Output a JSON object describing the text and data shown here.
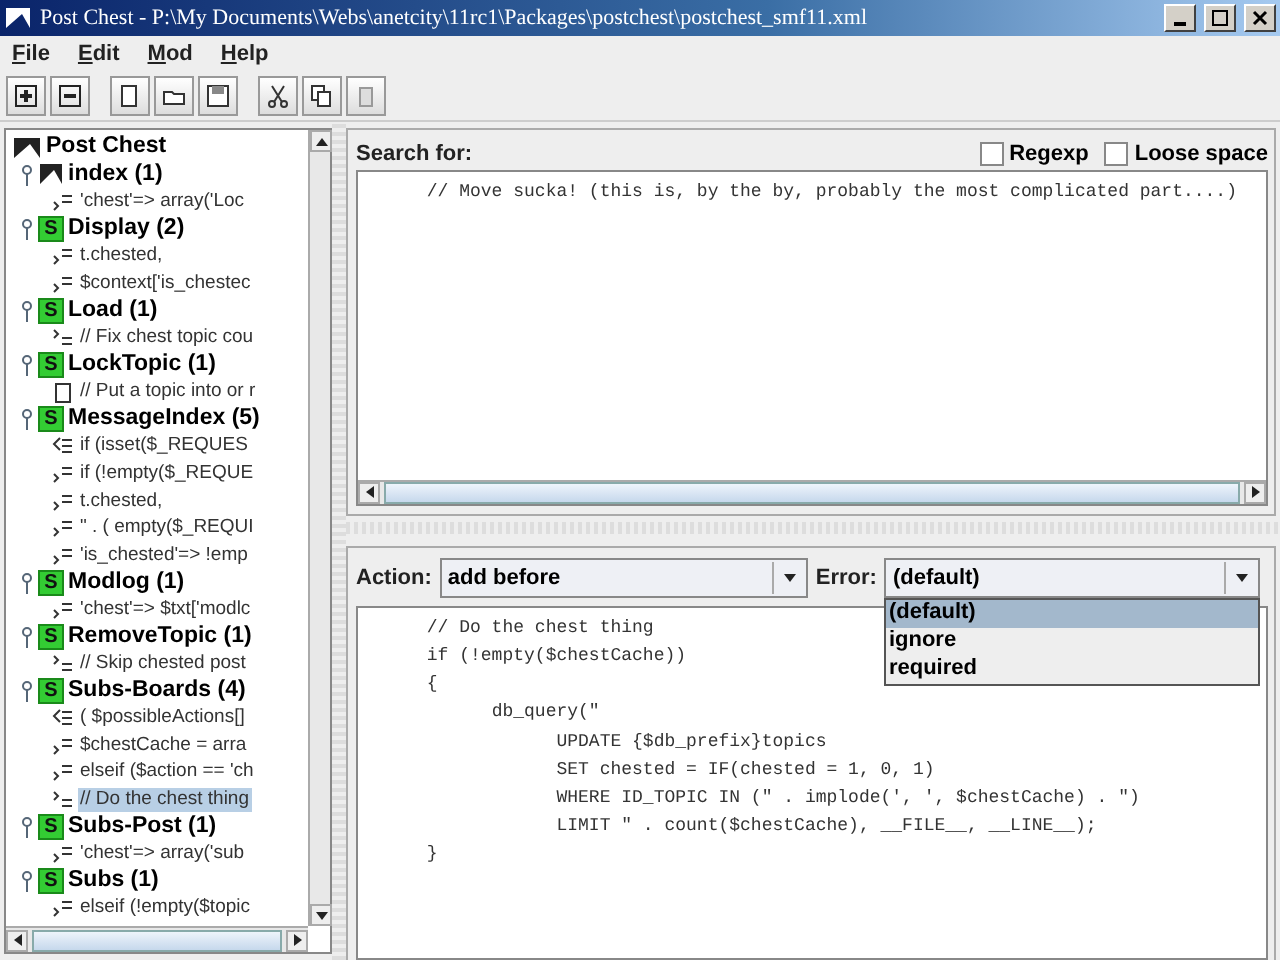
{
  "window": {
    "title": "Post Chest - P:\\My Documents\\Webs\\anetcity\\11rc1\\Packages\\postchest\\postchest_smf11.xml"
  },
  "menu": [
    "File",
    "Edit",
    "Mod",
    "Help"
  ],
  "tree": {
    "label": "Post Chest",
    "children": [
      {
        "label": "index (1)",
        "kind": "index",
        "children": [
          {
            "text": "'chest'=> array('Loc",
            "kind": "after",
            "selected": false
          }
        ]
      },
      {
        "label": "Display (2)",
        "kind": "source",
        "badge": "S",
        "children": [
          {
            "text": "t.chested,",
            "kind": "after",
            "selected": false
          },
          {
            "text": "$context['is_chestec",
            "kind": "after",
            "selected": false
          }
        ]
      },
      {
        "label": "Load (1)",
        "kind": "source",
        "badge": "S",
        "children": [
          {
            "text": "// Fix chest topic cou",
            "kind": "before",
            "selected": false
          }
        ]
      },
      {
        "label": "LockTopic (1)",
        "kind": "source",
        "badge": "S",
        "children": [
          {
            "text": "// Put a topic into or r",
            "kind": "file",
            "selected": false
          }
        ]
      },
      {
        "label": "MessageIndex (5)",
        "kind": "source",
        "badge": "S",
        "children": [
          {
            "text": "if (isset($_REQUES",
            "kind": "replace",
            "selected": false
          },
          {
            "text": "if (!empty($_REQUE",
            "kind": "after",
            "selected": false
          },
          {
            "text": "t.chested,",
            "kind": "after",
            "selected": false
          },
          {
            "text": "\" . ( empty($_REQUI",
            "kind": "after",
            "selected": false
          },
          {
            "text": "'is_chested'=> !emp",
            "kind": "after",
            "selected": false
          }
        ]
      },
      {
        "label": "Modlog (1)",
        "kind": "source",
        "badge": "S",
        "children": [
          {
            "text": "'chest'=> $txt['modlc",
            "kind": "after",
            "selected": false
          }
        ]
      },
      {
        "label": "RemoveTopic (1)",
        "kind": "source",
        "badge": "S",
        "children": [
          {
            "text": "// Skip chested post",
            "kind": "before",
            "selected": false
          }
        ]
      },
      {
        "label": "Subs-Boards (4)",
        "kind": "source",
        "badge": "S",
        "children": [
          {
            "text": "( $possibleActions[]",
            "kind": "replace",
            "selected": false
          },
          {
            "text": "$chestCache = arra",
            "kind": "after",
            "selected": false
          },
          {
            "text": "elseif ($action == 'ch",
            "kind": "after",
            "selected": false
          },
          {
            "text": "// Do the chest thing",
            "kind": "before",
            "selected": true
          }
        ]
      },
      {
        "label": "Subs-Post (1)",
        "kind": "source",
        "badge": "S",
        "children": [
          {
            "text": "'chest'=> array('sub",
            "kind": "after",
            "selected": false
          }
        ]
      },
      {
        "label": "Subs (1)",
        "kind": "source",
        "badge": "S",
        "children": [
          {
            "text": "elseif (!empty($topic",
            "kind": "after",
            "selected": false
          }
        ]
      }
    ]
  },
  "search": {
    "label": "Search for:",
    "options": [
      {
        "label": "Regexp",
        "checked": false
      },
      {
        "label": "Loose space",
        "checked": false
      }
    ],
    "lines": [
      "\t// Move sucka! (this is, by the by, probably the most complicated part....)"
    ]
  },
  "action": {
    "label": "Action:",
    "value": "add before"
  },
  "error": {
    "label": "Error:",
    "value": "(default)",
    "expanded": true,
    "options": [
      {
        "label": "(default)",
        "selected": true
      },
      {
        "label": "ignore",
        "selected": false
      },
      {
        "label": "required",
        "selected": false
      }
    ]
  },
  "code": {
    "lines": [
      "\t// Do the chest thing",
      "\tif (!empty($chestCache))",
      "\t{",
      "\t\tdb_query(\"",
      "\t\t\tUPDATE {$db_prefix}topics",
      "\t\t\tSET chested = IF(chested = 1, 0, 1)",
      "\t\t\tWHERE ID_TOPIC IN (\" . implode(', ', $chestCache) . \")",
      "\t\t\tLIMIT \" . count($chestCache), __FILE__, __LINE__);",
      "\t}"
    ]
  }
}
